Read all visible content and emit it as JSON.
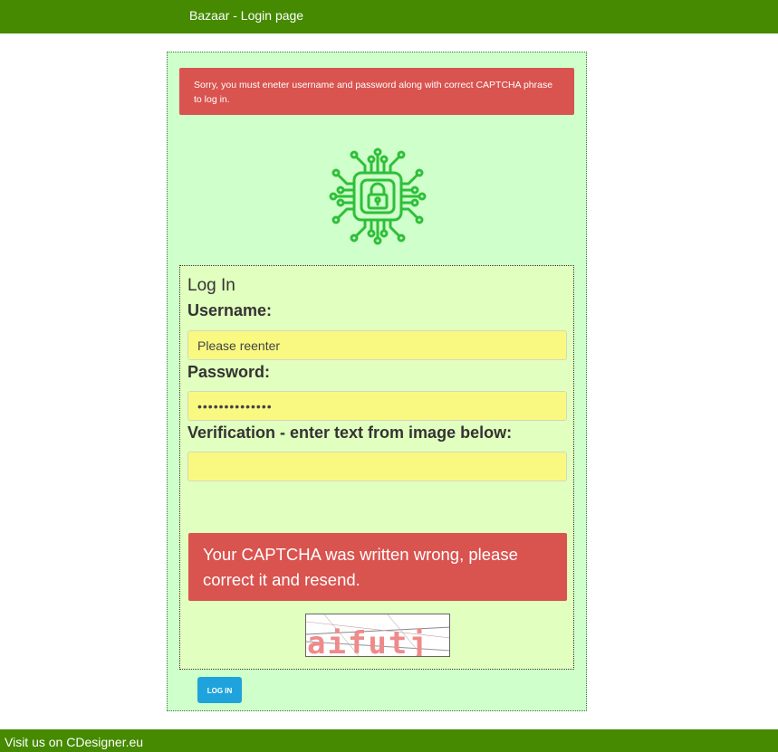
{
  "header": {
    "title": "Bazaar - Login page"
  },
  "alert_message": "Sorry, you must eneter username and password along with correct CAPTCHA phrase to log in.",
  "logo_icon": "circuit-lock-icon",
  "form": {
    "legend": "Log In",
    "username_label": "Username:",
    "username_value": "Please reenter",
    "password_label": "Password:",
    "password_value": "••••••••••••••",
    "verification_label": "Verification - enter text from image below:",
    "verification_value": "",
    "captcha_error": "Your CAPTCHA was written wrong, please correct it and resend.",
    "captcha_text": "aifutj",
    "submit_label": "LOG IN"
  },
  "footer": {
    "text": "Visit us on CDesigner.eu"
  },
  "colors": {
    "header_bg": "#458a00",
    "panel_bg": "#cfffca",
    "form_bg": "#e1ffbe",
    "input_bg": "#f9f982",
    "alert_bg": "#d9534f",
    "button_bg": "#1fa3dc",
    "icon_green": "#2fbf3a"
  }
}
